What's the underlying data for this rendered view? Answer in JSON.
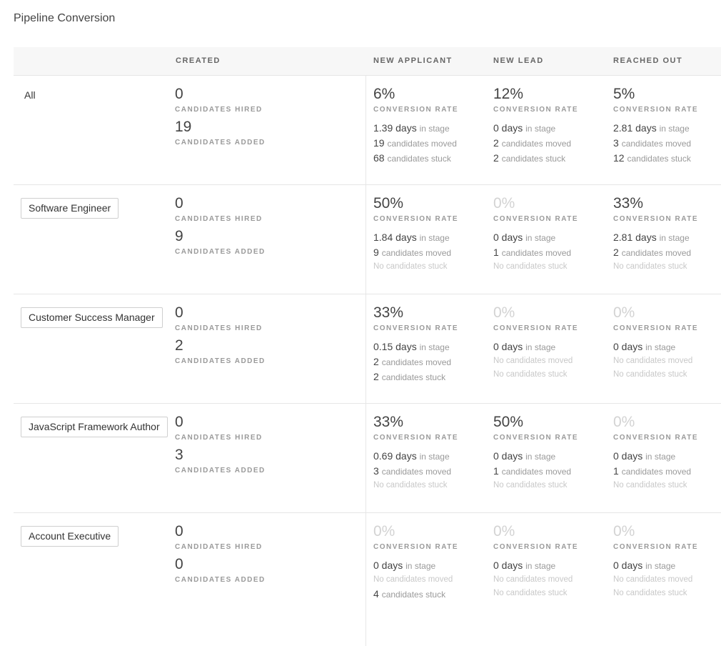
{
  "title": "Pipeline Conversion",
  "columns": {
    "created": "CREATED",
    "stages": [
      "NEW APPLICANT",
      "NEW LEAD",
      "REACHED OUT"
    ]
  },
  "labels": {
    "candidates_hired": "CANDIDATES HIRED",
    "candidates_added": "CANDIDATES ADDED",
    "conversion_rate": "CONVERSION RATE",
    "in_stage": "in stage",
    "candidates_moved": "candidates moved",
    "candidates_stuck": "candidates stuck",
    "no_moved": "No candidates moved",
    "no_stuck": "No candidates stuck"
  },
  "rows": [
    {
      "name": "All",
      "button": false,
      "hired": "0",
      "added": "19",
      "stages": [
        {
          "rate": "6%",
          "zero": false,
          "days": "1.39 days",
          "moved": "19",
          "stuck": "68"
        },
        {
          "rate": "12%",
          "zero": false,
          "days": "0 days",
          "moved": "2",
          "stuck": "2"
        },
        {
          "rate": "5%",
          "zero": false,
          "days": "2.81 days",
          "moved": "3",
          "stuck": "12"
        }
      ]
    },
    {
      "name": "Software Engineer",
      "button": true,
      "hired": "0",
      "added": "9",
      "stages": [
        {
          "rate": "50%",
          "zero": false,
          "days": "1.84 days",
          "moved": "9",
          "stuck": null
        },
        {
          "rate": "0%",
          "zero": true,
          "days": "0 days",
          "moved": "1",
          "stuck": null
        },
        {
          "rate": "33%",
          "zero": false,
          "days": "2.81 days",
          "moved": "2",
          "stuck": null
        }
      ]
    },
    {
      "name": "Customer Success Manager",
      "button": true,
      "hired": "0",
      "added": "2",
      "stages": [
        {
          "rate": "33%",
          "zero": false,
          "days": "0.15 days",
          "moved": "2",
          "stuck": "2"
        },
        {
          "rate": "0%",
          "zero": true,
          "days": "0 days",
          "moved": null,
          "stuck": null
        },
        {
          "rate": "0%",
          "zero": true,
          "days": "0 days",
          "moved": null,
          "stuck": null
        }
      ]
    },
    {
      "name": "JavaScript Framework Author",
      "button": true,
      "hired": "0",
      "added": "3",
      "stages": [
        {
          "rate": "33%",
          "zero": false,
          "days": "0.69 days",
          "moved": "3",
          "stuck": null
        },
        {
          "rate": "50%",
          "zero": false,
          "days": "0 days",
          "moved": "1",
          "stuck": null
        },
        {
          "rate": "0%",
          "zero": true,
          "days": "0 days",
          "moved": "1",
          "stuck": null
        }
      ]
    },
    {
      "name": "Account Executive",
      "button": true,
      "hired": "0",
      "added": "0",
      "stages": [
        {
          "rate": "0%",
          "zero": true,
          "days": "0 days",
          "moved": null,
          "stuck": "4"
        },
        {
          "rate": "0%",
          "zero": true,
          "days": "0 days",
          "moved": null,
          "stuck": null
        },
        {
          "rate": "0%",
          "zero": true,
          "days": "0 days",
          "moved": null,
          "stuck": null
        }
      ]
    }
  ]
}
